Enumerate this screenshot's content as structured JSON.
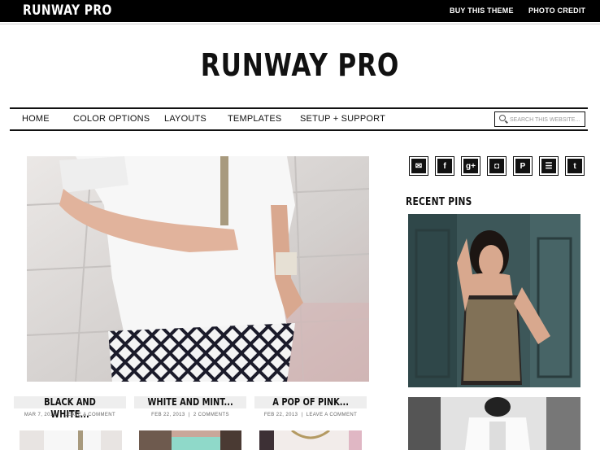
{
  "topbar": {
    "logo": "RUNWAY PRO",
    "links": [
      "BUY THIS THEME",
      "PHOTO CREDIT"
    ]
  },
  "header": {
    "title": "RUNWAY PRO"
  },
  "nav": {
    "items": [
      "HOME",
      "COLOR OPTIONS",
      "LAYOUTS",
      "TEMPLATES",
      "SETUP + SUPPORT"
    ],
    "search_placeholder": "SEARCH THIS WEBSITE..."
  },
  "posts": [
    {
      "title": "BLACK AND WHITE...",
      "date": "MAR 7, 2013",
      "comments": "LEAVE A COMMENT"
    },
    {
      "title": "WHITE AND MINT...",
      "date": "FEB 22, 2013",
      "comments": "2 COMMENTS"
    },
    {
      "title": "A POP OF PINK...",
      "date": "FEB 22, 2013",
      "comments": "LEAVE A COMMENT"
    }
  ],
  "sidebar": {
    "social_icons": [
      "email-icon",
      "facebook-icon",
      "google-plus-icon",
      "instagram-icon",
      "pinterest-icon",
      "rss-icon",
      "twitter-icon"
    ],
    "social_glyphs": [
      "✉",
      "f",
      "g+",
      "◘",
      "P",
      "☰",
      "t"
    ],
    "pins_heading": "RECENT PINS"
  },
  "colors": {
    "bar": "#000000",
    "background": "#ffffff",
    "title_bar": "#eeeeee"
  }
}
